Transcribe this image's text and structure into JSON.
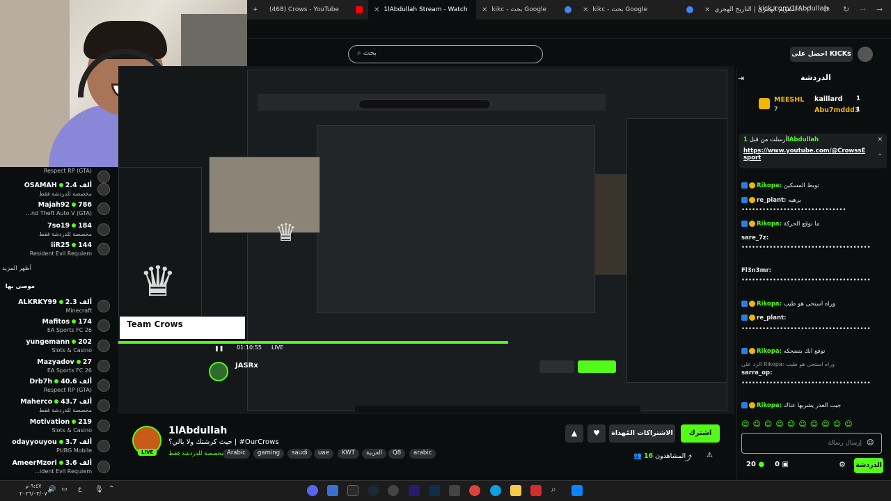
{
  "browser": {
    "tabs": [
      {
        "label": "(468) Crows - YouTube",
        "color": "#ff0000"
      },
      {
        "label": "1lAbdullah Stream - Watch",
        "color": "#53fc18"
      },
      {
        "label": "kikc - بحث Google",
        "color": "#4285f4"
      },
      {
        "label": "kikc - بحث Google",
        "color": "#4285f4"
      },
      {
        "label": "التقويم الهجري | التاريخ الهجري ..",
        "color": "#1a9c4a"
      }
    ],
    "url": "kick.com/1lAbdullah"
  },
  "header": {
    "search_placeholder": "بحث",
    "get_kicks": "احصل على KICKs"
  },
  "following": {
    "rows_top": [
      {
        "name": "",
        "sub": "Respect RP (GTA)",
        "count": ""
      },
      {
        "name": "OSAMAH",
        "sub": "مخصصة للدردشة فقط",
        "count": "2.4 ألف"
      },
      {
        "name": "Majah92",
        "sub": "...nd Theft Auto V (GTA)",
        "count": "786"
      },
      {
        "name": "7so19",
        "sub": "مخصصة للدردشة فقط",
        "count": "184"
      },
      {
        "name": "iiR25",
        "sub": "Resident Evil Requiem",
        "count": "144"
      }
    ],
    "show_more": "أظهر المزيد",
    "recommended": "موصى بها",
    "rows_bottom": [
      {
        "name": "ALKRKY99",
        "sub": "Minecraft",
        "count": "2.3 ألف"
      },
      {
        "name": "Mafitos",
        "sub": "EA Sports FC 26",
        "count": "174"
      },
      {
        "name": "yungemann",
        "sub": "Slots & Casino",
        "count": "202"
      },
      {
        "name": "Mazyadov",
        "sub": "EA Sports FC 26",
        "count": "27"
      },
      {
        "name": "Drb7h",
        "sub": "Respect RP (GTA)",
        "count": "40.6 ألف"
      },
      {
        "name": "Maherco",
        "sub": "مخصصة للدردشة فقط",
        "count": "43.7 ألف"
      },
      {
        "name": "Motivation",
        "sub": "Slots & Casino",
        "count": "219"
      },
      {
        "name": "odayyouyou",
        "sub": "PUBG Mobile",
        "count": "3.7 ألف"
      },
      {
        "name": "AmeerMzori",
        "sub": "...ident Evil Requiem",
        "count": "3.6 ألف"
      }
    ]
  },
  "stream_overlay": {
    "team": "Team Crows",
    "inner_name": "JASRx",
    "time": "01:10:55",
    "live": "LIVE"
  },
  "stream": {
    "name": "1lAbdullah",
    "title": "حيث كرشتك ولا بالي؟ | #OurCrows",
    "live": "LIVE",
    "category": "مخصصة للدردشة فقط",
    "tags": [
      "Arabic",
      "gaming",
      "saudi",
      "uae",
      "KWT",
      "العربية",
      "Q8",
      "arabic"
    ],
    "subscribe": "اشترك",
    "gift_subs": "الاشتراكات المُهداة",
    "viewers_label": "المشاهدون",
    "viewers": "16"
  },
  "chat": {
    "title": "الدردشة",
    "gifters": [
      {
        "name": "MEESHL",
        "count": "7"
      },
      {
        "name": "kaillard",
        "count": "1"
      },
      {
        "name": "Abu7mddd3",
        "count": "1"
      }
    ],
    "pinned_from": "أرسلت من قبل",
    "pinned_user": "1lAbdullah",
    "pinned_link": "https://www.youtube.com/@CrowssEsport",
    "messages": [
      {
        "user": "Rikopa:",
        "text": "توبط المسكين",
        "style": "g"
      },
      {
        "user": "re_plant:",
        "text": "برهيه",
        "style": "w"
      },
      {
        "user": "",
        "text": "••••••••••••••••••••••••••••••",
        "style": ""
      },
      {
        "user": "Rikopa:",
        "text": "ما توقع الحركة",
        "style": "g"
      },
      {
        "user": "sare_7z:",
        "text": "",
        "style": "w"
      },
      {
        "user": "",
        "text": "•••••••••••••••••••••••••••••••••••••",
        "style": ""
      },
      {
        "user": "Fl3n3mr:",
        "text": "",
        "style": "w"
      },
      {
        "user": "",
        "text": "•••••••••••••••••••••••••••••••••••••",
        "style": ""
      },
      {
        "user": "Rikopa:",
        "text": "وراه استحى هو طيب",
        "style": "g"
      },
      {
        "user": "re_plant:",
        "text": "",
        "style": "w"
      },
      {
        "user": "",
        "text": "•••••••••••••••••••••••••••••••••••••",
        "style": ""
      },
      {
        "user": "Rikopa:",
        "text": "توقع انك بتضحكه",
        "style": "g"
      },
      {
        "user": "",
        "text": "الرد على Rikopa: وراه استحى هو طيب",
        "style": ""
      },
      {
        "user": "sarra_op:",
        "text": "",
        "style": "w"
      },
      {
        "user": "",
        "text": "•••••••••••••••••••••••••••••••••••••",
        "style": ""
      },
      {
        "user": "Rikopa:",
        "text": "جيب العذر يشربها عناك",
        "style": "g"
      }
    ],
    "input_placeholder": "إرسال رسالة",
    "send": "الدردشة",
    "kicks_count": "20",
    "points": "0"
  },
  "taskbar": {
    "time": "٩:٤٧ م",
    "date": "٢٠٢٦/٠٣/٠٧"
  }
}
